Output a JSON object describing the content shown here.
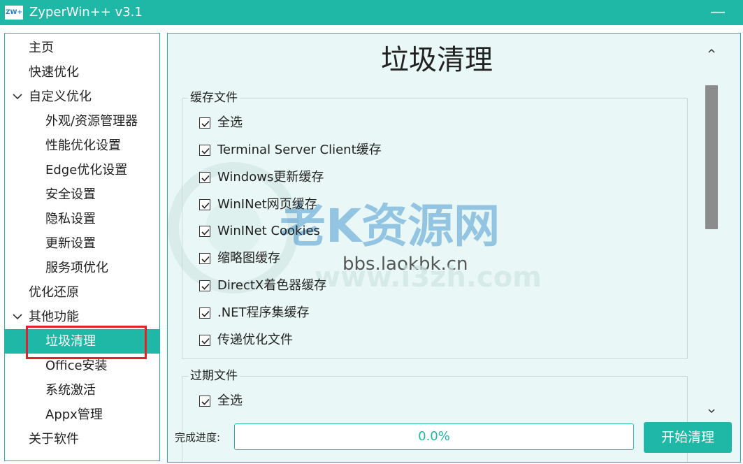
{
  "window": {
    "logo_text": "ZW+",
    "title": "ZyperWin++ v3.1",
    "close_glyph": "—"
  },
  "sidebar": {
    "items": [
      {
        "label": "主页"
      },
      {
        "label": "快速优化"
      },
      {
        "label": "自定义优化"
      },
      {
        "label": "外观/资源管理器"
      },
      {
        "label": "性能优化设置"
      },
      {
        "label": "Edge优化设置"
      },
      {
        "label": "安全设置"
      },
      {
        "label": "隐私设置"
      },
      {
        "label": "更新设置"
      },
      {
        "label": "服务项优化"
      },
      {
        "label": "优化还原"
      },
      {
        "label": "其他功能"
      },
      {
        "label": "垃圾清理"
      },
      {
        "label": "Office安装"
      },
      {
        "label": "系统激活"
      },
      {
        "label": "Appx管理"
      },
      {
        "label": "关于软件"
      }
    ]
  },
  "main": {
    "title": "垃圾清理",
    "groups": [
      {
        "title": "缓存文件",
        "items": [
          {
            "label": "全选",
            "checked": true
          },
          {
            "label": "Terminal Server Client缓存",
            "checked": true
          },
          {
            "label": "Windows更新缓存",
            "checked": true
          },
          {
            "label": "WinINet网页缓存",
            "checked": true
          },
          {
            "label": "WinINet Cookies",
            "checked": true
          },
          {
            "label": "缩略图缓存",
            "checked": true
          },
          {
            "label": "DirectX着色器缓存",
            "checked": true
          },
          {
            "label": ".NET程序集缓存",
            "checked": true
          },
          {
            "label": "传递优化文件",
            "checked": true
          }
        ]
      },
      {
        "title": "过期文件",
        "items": [
          {
            "label": "全选",
            "checked": true
          }
        ]
      }
    ],
    "progress_label": "完成进度:",
    "progress_percent": 0.0,
    "progress_text": "0.0%",
    "start_label": "开始清理"
  },
  "watermark": {
    "brand": "老K资源网",
    "url_main": "bbs.laokbk.cn",
    "url_faint": "www.i3zh.com"
  },
  "colors": {
    "accent": "#1fb8a6",
    "panel_bg": "#e9f8f6",
    "highlight": "#e0232a",
    "watermark_blue": "#2d86c9"
  },
  "icons": {
    "expand": "chevron-down-icon",
    "check": "check-icon",
    "scroll_up": "chevron-up-icon",
    "scroll_down": "chevron-down-icon",
    "close": "minimize-icon"
  }
}
